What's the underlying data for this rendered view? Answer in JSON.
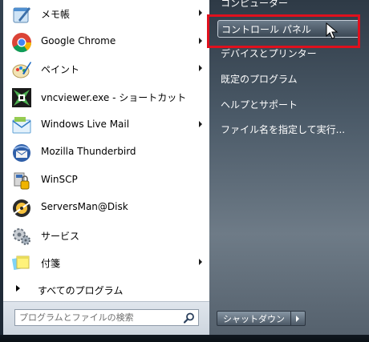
{
  "programs": [
    {
      "label": "メモ帳",
      "icon": "notepad-icon",
      "has_submenu": true
    },
    {
      "label": "Google Chrome",
      "icon": "chrome-icon",
      "has_submenu": true
    },
    {
      "label": "ペイント",
      "icon": "paint-icon",
      "has_submenu": true
    },
    {
      "label": "vncviewer.exe - ショートカット",
      "icon": "vnc-viewer-icon",
      "has_submenu": false
    },
    {
      "label": "Windows Live Mail",
      "icon": "live-mail-icon",
      "has_submenu": true
    },
    {
      "label": "Mozilla Thunderbird",
      "icon": "thunderbird-icon",
      "has_submenu": false
    },
    {
      "label": "WinSCP",
      "icon": "winscp-icon",
      "has_submenu": false
    },
    {
      "label": "ServersMan@Disk",
      "icon": "serversman-icon",
      "has_submenu": false
    },
    {
      "label": "サービス",
      "icon": "services-icon",
      "has_submenu": false
    },
    {
      "label": "付箋",
      "icon": "sticky-notes-icon",
      "has_submenu": true
    }
  ],
  "all_programs_label": "すべてのプログラム",
  "search": {
    "placeholder": "プログラムとファイルの検索"
  },
  "right": {
    "computer": "コンピューター",
    "control_panel": "コントロール パネル",
    "devices_printers": "デバイスとプリンター",
    "default_programs": "既定のプログラム",
    "help_support": "ヘルプとサポート",
    "run": "ファイル名を指定して実行..."
  },
  "shutdown_label": "シャットダウン",
  "colors": {
    "highlight": "#e0101d",
    "pane_dark": "#4b5a68"
  }
}
